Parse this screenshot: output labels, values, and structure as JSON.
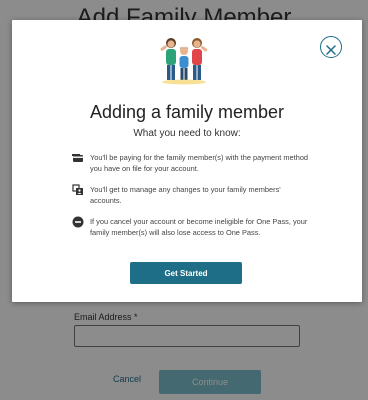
{
  "background": {
    "title": "Add Family Member",
    "email_label": "Email Address *",
    "cancel_label": "Cancel",
    "continue_label": "Continue"
  },
  "modal": {
    "title": "Adding a family member",
    "subtitle": "What you need to know:",
    "items": [
      {
        "icon": "credit-card-icon",
        "text": "You'll be paying for the family member(s) with the payment method you have on file for your account."
      },
      {
        "icon": "manage-accounts-icon",
        "text": "You'll get to manage any changes to your family members' accounts."
      },
      {
        "icon": "minus-circle-icon",
        "text": "If you cancel your account or become ineligible for One Pass, your family member(s) will also lose access to One Pass."
      }
    ],
    "button_label": "Get Started",
    "close_icon": "close-icon"
  },
  "colors": {
    "accent": "#1d6e86",
    "overlay": "rgba(0,0,0,0.45)",
    "continue_disabled": "#7fbfcd"
  }
}
